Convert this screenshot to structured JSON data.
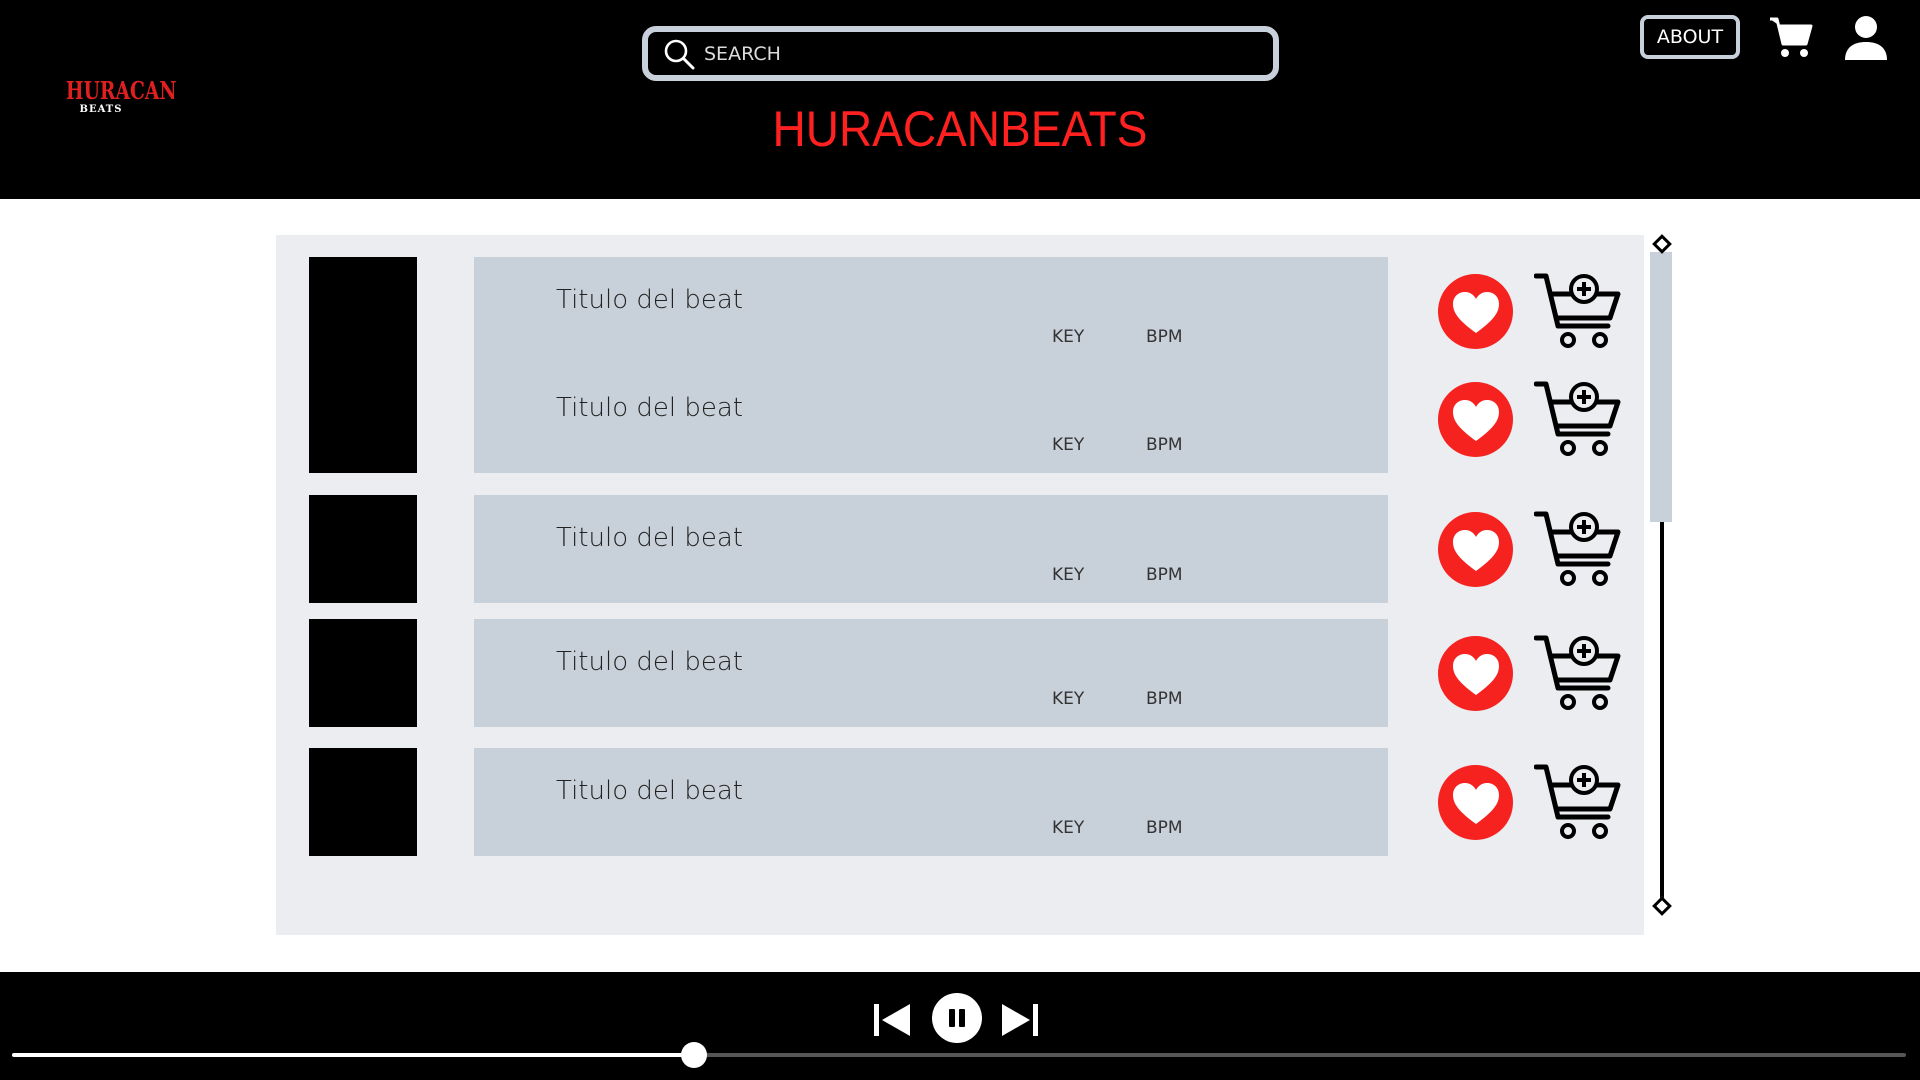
{
  "logo": {
    "main": "HURACAN",
    "sub": "BEATS"
  },
  "search": {
    "placeholder": "SEARCH",
    "value": ""
  },
  "site_title": "HURACANBEATS",
  "nav": {
    "about_label": "ABOUT"
  },
  "beats": [
    {
      "title": "Titulo del beat",
      "key_label": "KEY",
      "bpm_label": "BPM"
    },
    {
      "title": "Titulo del beat",
      "key_label": "KEY",
      "bpm_label": "BPM"
    },
    {
      "title": "Titulo del beat",
      "key_label": "KEY",
      "bpm_label": "BPM"
    },
    {
      "title": "Titulo del beat",
      "key_label": "KEY",
      "bpm_label": "BPM"
    },
    {
      "title": "Titulo del beat",
      "key_label": "KEY",
      "bpm_label": "BPM"
    }
  ],
  "player": {
    "progress": 0.36
  },
  "icons": {
    "search": "search-icon",
    "cart": "cart-icon",
    "user": "user-icon",
    "heart": "heart-icon",
    "add_to_cart": "add-to-cart-icon",
    "prev": "skip-previous-icon",
    "pause": "pause-icon",
    "next": "skip-next-icon"
  },
  "colors": {
    "accent": "#ff2020",
    "header_bg": "#000000",
    "panel_bg": "#ecedf0",
    "card_bg": "#c8d0d9",
    "heart_bg": "#f5221f"
  }
}
